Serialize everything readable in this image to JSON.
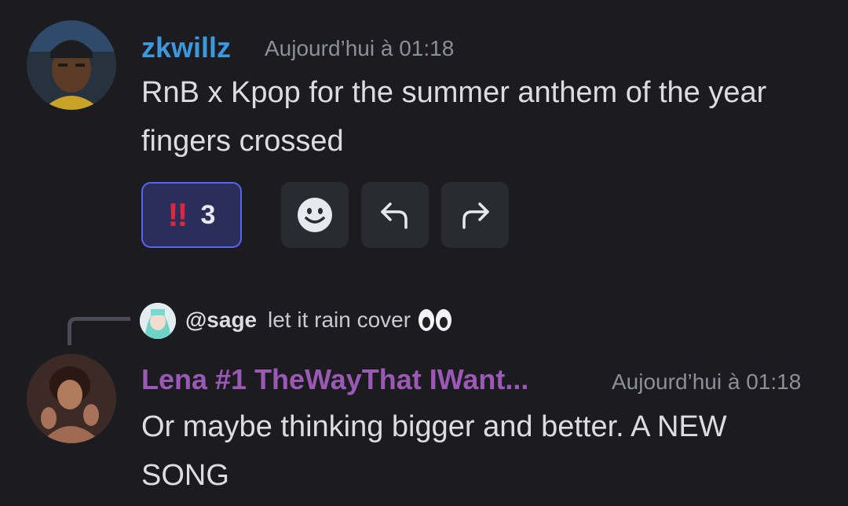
{
  "colors": {
    "background": "#1c1c20",
    "username1": "#3d97dc",
    "username2": "#9b59b6",
    "reaction_border": "#5865f2"
  },
  "message1": {
    "username": "zkwillz",
    "timestamp": "Aujourd’hui à 01:18",
    "text": "RnB x Kpop for the summer anthem of the year fingers crossed",
    "reaction": {
      "emoji": "double-exclamation-icon",
      "count": "3"
    },
    "actions": [
      "add-reaction-icon",
      "reply-icon",
      "forward-icon"
    ]
  },
  "reply_ref": {
    "handle": "@sage",
    "text": "let it rain cover",
    "emoji": "eyes-icon"
  },
  "message2": {
    "username": "Lena #1 TheWayThat IWant...",
    "timestamp": "Aujourd’hui à 01:18",
    "text": "Or maybe thinking bigger and better. A NEW SONG"
  }
}
